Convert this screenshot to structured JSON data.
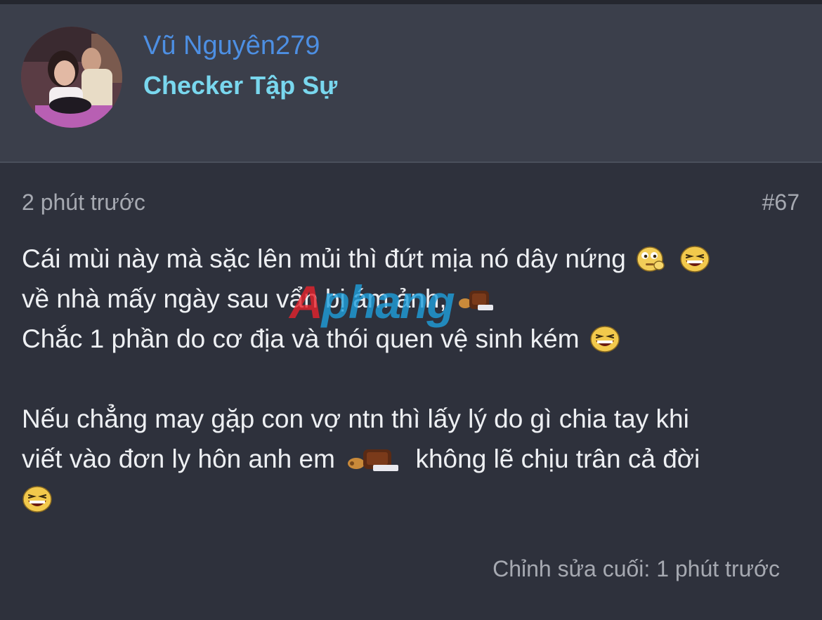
{
  "author": {
    "username": "Vũ Nguyên279",
    "title": "Checker Tập Sự"
  },
  "post": {
    "time": "2 phút trước",
    "number": "#67",
    "lines": {
      "l1": "Cái mùi này mà sặc lên mủi thì đứt mịa nó dây nứng",
      "l2": "về nhà mấy ngày sau vẩn bị ám ảnh,",
      "l3": "Chắc 1 phần do cơ địa và thói quen vệ sinh kém",
      "l4": "Nếu chẳng may gặp con vợ ntn thì lấy lý do gì chia tay khi",
      "l5a": "viết vào đơn ly hôn anh em",
      "l5b": "không lẽ chịu trân cả đời"
    },
    "edit_note": "Chỉnh sửa cuối: 1 phút trước"
  },
  "smileys": {
    "thinking": "thinking-smiley-icon",
    "laughing": "laughing-smiley-icon",
    "bear": "bear-smiley-icon"
  },
  "watermark": {
    "part1": "A",
    "part2": "phang"
  },
  "colors": {
    "username": "#4d8fe3",
    "user_title": "#79d7ee",
    "background": "#2e313c",
    "header_background": "#3b3f4b",
    "text": "#eef0f3",
    "meta_text": "#a6a9b1"
  }
}
